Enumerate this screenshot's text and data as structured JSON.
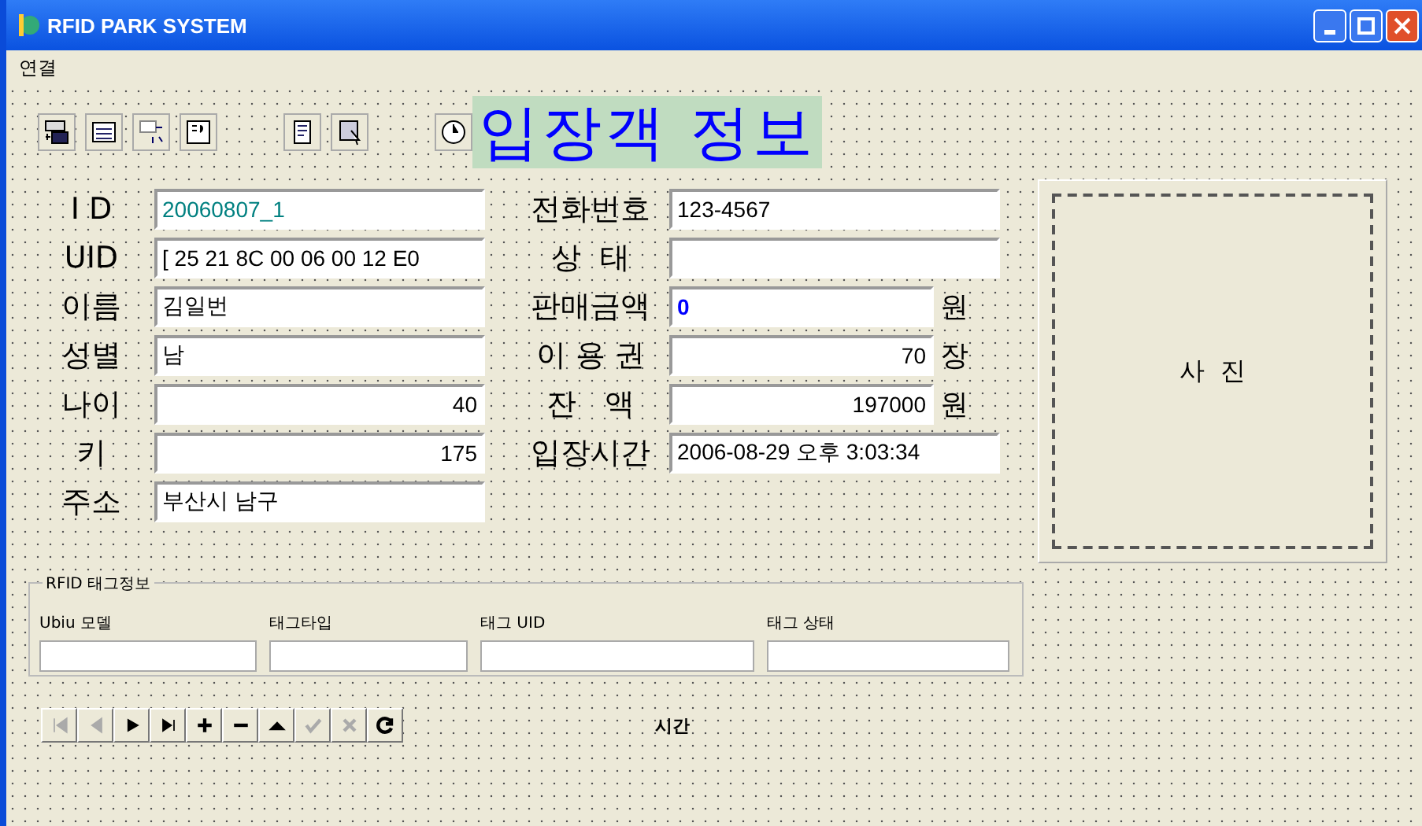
{
  "window": {
    "title": "RFID PARK SYSTEM"
  },
  "menu": [
    "연결"
  ],
  "toolbar": [
    {
      "kind": "ado-connect"
    },
    {
      "kind": "ado-grid"
    },
    {
      "kind": "transfer"
    },
    {
      "kind": "ado-query"
    },
    {
      "kind": "gap"
    },
    {
      "kind": "form"
    },
    {
      "kind": "cursor"
    },
    {
      "kind": "gap"
    },
    {
      "kind": "clock"
    }
  ],
  "heading": "입장객 정보",
  "left_fields": [
    {
      "label": "I D",
      "value": "20060807_1",
      "kind": "text",
      "color": "#008080"
    },
    {
      "label": "UID",
      "value": "[ 25 21 8C 00 06 00 12 E0",
      "kind": "text"
    },
    {
      "label": "이름",
      "value": "김일번",
      "kind": "text"
    },
    {
      "label": "성별",
      "value": "남",
      "kind": "text"
    },
    {
      "label": "나이",
      "value": "40",
      "kind": "number"
    },
    {
      "label": "키",
      "value": "175",
      "kind": "number"
    },
    {
      "label": "주소",
      "value": "부산시 남구",
      "kind": "text"
    }
  ],
  "right_fields": [
    {
      "label": "전화번호",
      "value": "123-4567",
      "kind": "text"
    },
    {
      "label": "상  태",
      "kind": "text"
    },
    {
      "label": "판매금액",
      "value": "0",
      "unit": "원",
      "kind": "text",
      "color": "#0000ff"
    },
    {
      "label": "이 용 권",
      "value": "70",
      "unit": "장",
      "kind": "number"
    },
    {
      "label": "잔   액",
      "value": "197000",
      "unit": "원",
      "kind": "number"
    },
    {
      "label": "입장시간",
      "value": "2006-08-29 오후 3:03:34",
      "kind": "text"
    }
  ],
  "photo": {
    "label": "사  진"
  },
  "tag_info": {
    "title": "RFID 태그정보",
    "columns": [
      "Ubiu 모델",
      "태그타입",
      "태그 UID",
      "태그 상태"
    ]
  },
  "navigator": [
    {
      "kind": "first",
      "disabled": true
    },
    {
      "kind": "prior",
      "disabled": true
    },
    {
      "kind": "next",
      "disabled": false
    },
    {
      "kind": "last",
      "disabled": false
    },
    {
      "kind": "insert",
      "disabled": false
    },
    {
      "kind": "delete",
      "disabled": false
    },
    {
      "kind": "edit",
      "disabled": false
    },
    {
      "kind": "post",
      "disabled": true
    },
    {
      "kind": "cancel",
      "disabled": true
    },
    {
      "kind": "refresh",
      "disabled": false
    }
  ],
  "time_label": "시간"
}
